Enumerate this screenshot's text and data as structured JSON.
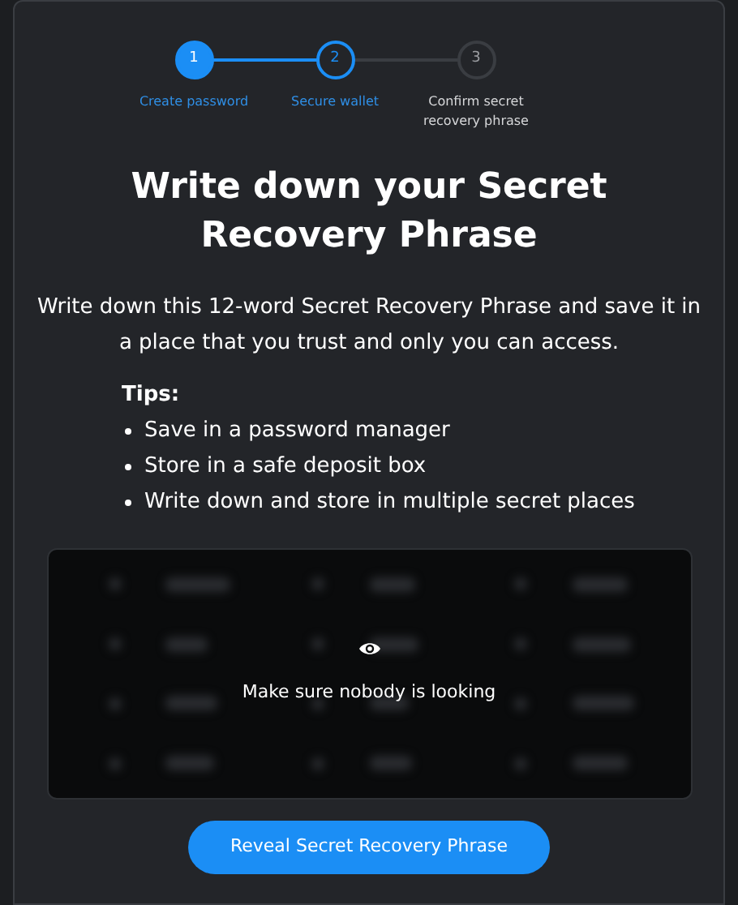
{
  "steps": [
    {
      "number": "1",
      "label": "Create password",
      "completed": true,
      "selected": false
    },
    {
      "number": "2",
      "label": "Secure wallet",
      "completed": false,
      "selected": true
    },
    {
      "number": "3",
      "label": "Confirm secret recovery phrase",
      "completed": false,
      "selected": false
    }
  ],
  "title": "Write down your Secret Recovery Phrase",
  "description": "Write down this 12-word Secret Recovery Phrase and save it in a place that you trust and only you can access.",
  "tips": {
    "heading": "Tips:",
    "items": [
      "Save in a password manager",
      "Store in a safe deposit box",
      "Write down and store in multiple secret places"
    ]
  },
  "phrase_box": {
    "message": "Make sure nobody is looking"
  },
  "reveal_button": "Reveal Secret Recovery Phrase"
}
